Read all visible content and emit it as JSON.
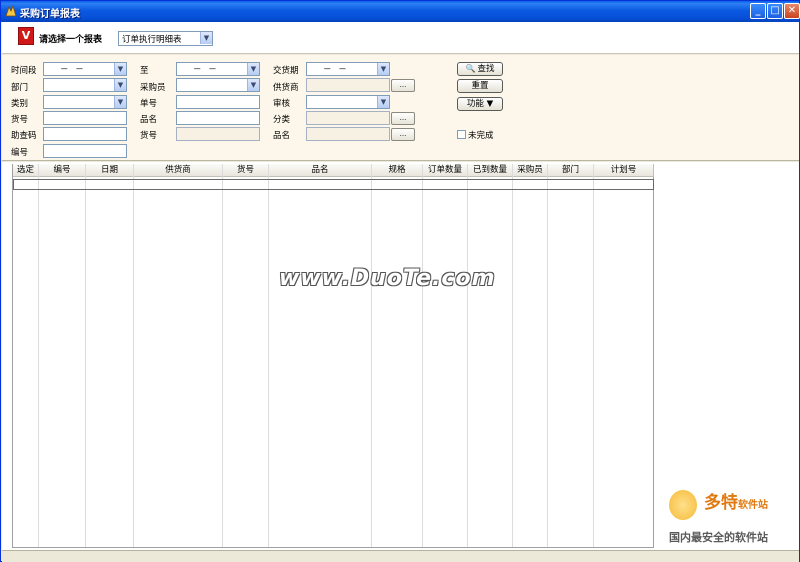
{
  "window": {
    "title": "采购订单报表",
    "minimize": "_",
    "maximize": "□",
    "close": "✕"
  },
  "toolbar": {
    "logo_text": "V",
    "report_label": "请选择一个报表",
    "report_select_value": "订单执行明细表"
  },
  "filters": {
    "time_label": "时间段",
    "time_from_value": "－ －",
    "to_label": "至",
    "time_to_value": "－ －",
    "delivery_label": "交货期",
    "delivery_value": "－ －",
    "dept_label": "部门",
    "buyer_label": "采购员",
    "supplier_label": "供货商",
    "category_label": "类别",
    "doc_no_label": "单号",
    "audit_label": "审核",
    "item_no_label": "货号",
    "item_name_label": "品名",
    "class_label": "分类",
    "search_code_label": "助查码",
    "item_no2_label": "货号",
    "item_name2_label": "品名",
    "number_label": "编号",
    "ellipsis": "...",
    "unfinished_label": "未完成"
  },
  "buttons": {
    "search": "查找",
    "reset": "重置",
    "functions": "功能 ▼"
  },
  "table": {
    "columns": [
      "选定",
      "编号",
      "日期",
      "供货商",
      "货号",
      "品名",
      "规格",
      "订单数量",
      "已到数量",
      "采购员",
      "部门",
      "计划号"
    ]
  },
  "watermark": "www.DuoTe.com",
  "brand": {
    "name": "多特",
    "suffix": "软件站",
    "slogan": "国内最安全的软件站"
  }
}
